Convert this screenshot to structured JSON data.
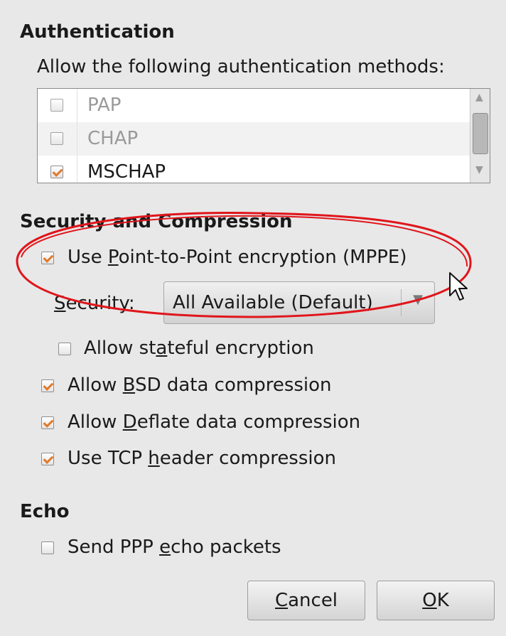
{
  "authentication": {
    "heading": "Authentication",
    "description": "Allow the following authentication methods:",
    "methods": [
      {
        "label": "PAP",
        "checked": false,
        "disabled": true
      },
      {
        "label": "CHAP",
        "checked": false,
        "disabled": true
      },
      {
        "label": "MSCHAP",
        "checked": true,
        "disabled": false
      }
    ]
  },
  "security": {
    "heading": "Security and Compression",
    "mppe": {
      "pre": "Use ",
      "mn": "P",
      "post": "oint-to-Point encryption (MPPE)",
      "checked": true
    },
    "security_label": {
      "mn": "S",
      "post": "ecurity:"
    },
    "security_value": "All Available (Default)",
    "stateful": {
      "pre": "Allow st",
      "mn": "a",
      "post": "teful encryption",
      "checked": false
    },
    "bsd": {
      "pre": "Allow ",
      "mn": "B",
      "post": "SD data compression",
      "checked": true
    },
    "deflate": {
      "pre": "Allow ",
      "mn": "D",
      "post": "eflate data compression",
      "checked": true
    },
    "tcp": {
      "pre": "Use TCP ",
      "mn": "h",
      "post": "eader compression",
      "checked": true
    }
  },
  "echo": {
    "heading": "Echo",
    "send": {
      "pre": "Send PPP ",
      "mn": "e",
      "post": "cho packets",
      "checked": false
    }
  },
  "buttons": {
    "cancel": {
      "mn": "C",
      "post": "ancel"
    },
    "ok": {
      "mn": "O",
      "post": "K"
    }
  },
  "colors": {
    "check_accent": "#e0792a",
    "annotation": "#e0151b",
    "dialog_bg": "#e8e8e8"
  }
}
